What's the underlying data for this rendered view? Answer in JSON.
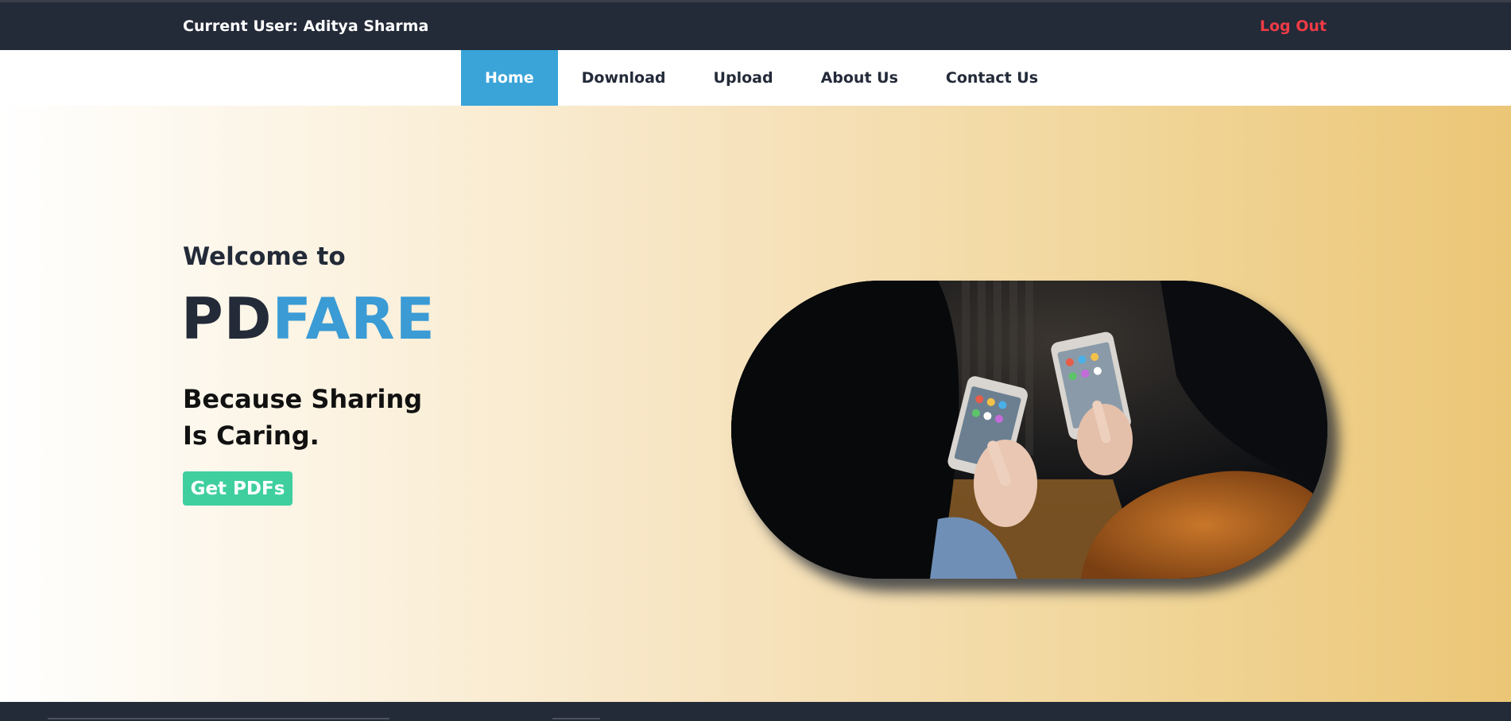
{
  "header": {
    "current_user": "Current User: Aditya Sharma",
    "logout_label": "Log Out"
  },
  "nav": {
    "items": [
      {
        "label": "Home",
        "active": true
      },
      {
        "label": "Download",
        "active": false
      },
      {
        "label": "Upload",
        "active": false
      },
      {
        "label": "About Us",
        "active": false
      },
      {
        "label": "Contact Us",
        "active": false
      }
    ]
  },
  "hero": {
    "welcome": "Welcome to",
    "brand_part1": "PD",
    "brand_part2": "FARE",
    "tagline": "Because Sharing Is Caring.",
    "cta_label": "Get PDFs",
    "image_description_icon": "people-using-phones-photo"
  },
  "colors": {
    "topbar": "#232a38",
    "accent_blue": "#3a9bd5",
    "nav_active": "#3aa4d8",
    "logout": "#ef3b45",
    "cta": "#3fcf9f",
    "hero_gradient_end": "#ebc676"
  }
}
